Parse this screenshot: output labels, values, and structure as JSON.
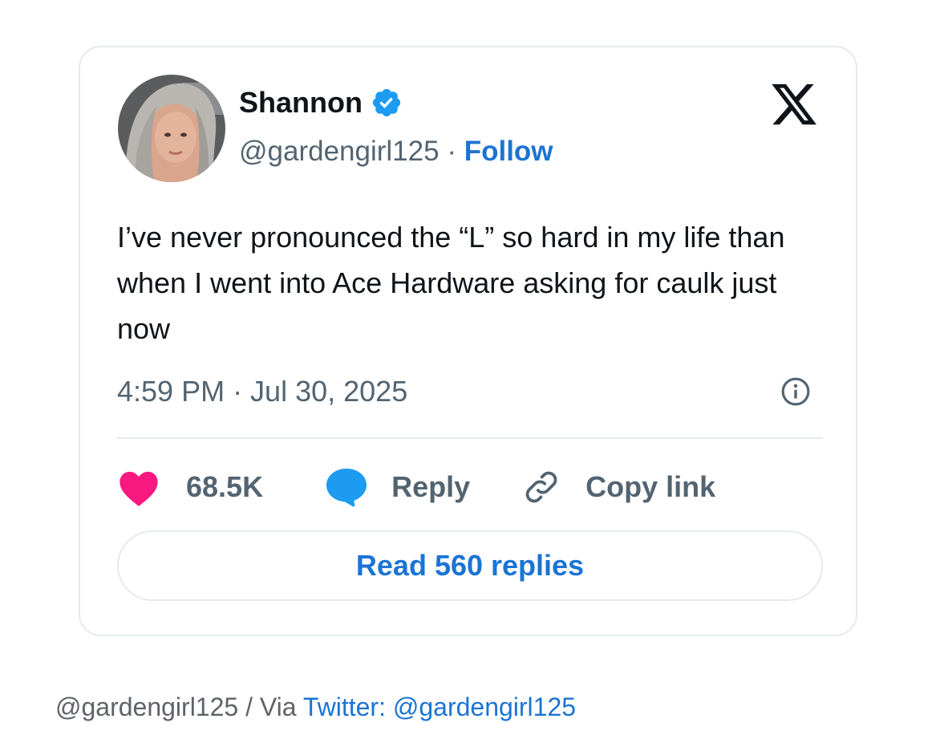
{
  "tweet": {
    "author_name": "Shannon",
    "handle": "@gardengirl125",
    "separator": "·",
    "follow_label": "Follow",
    "text": "I’ve never pronounced the “L” so hard in my life than when I went into Ace Hardware asking for caulk just now",
    "timestamp": "4:59 PM · Jul 30, 2025",
    "likes": "68.5K",
    "reply_label": "Reply",
    "copy_link_label": "Copy link",
    "read_replies_label": "Read 560 replies"
  },
  "caption": {
    "credit": "@gardengirl125 / Via ",
    "link_text": "Twitter: @gardengirl125"
  },
  "icons": {
    "verified": "verified-badge-icon",
    "platform": "x-logo-icon",
    "info": "info-icon",
    "like": "heart-icon",
    "reply": "speech-bubble-icon",
    "copy_link": "link-icon"
  },
  "colors": {
    "accent_blue": "#1b74d4",
    "verified_blue": "#1d9bf0",
    "heart_pink": "#f91880",
    "text_primary": "#0f1419",
    "text_secondary": "#536471",
    "border": "#e6eaed"
  }
}
